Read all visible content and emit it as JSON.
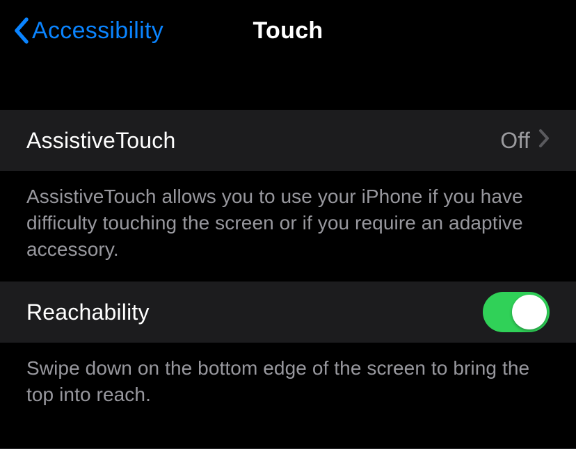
{
  "header": {
    "back_label": "Accessibility",
    "title": "Touch"
  },
  "sections": {
    "assistive_touch": {
      "label": "AssistiveTouch",
      "value": "Off",
      "footer": "AssistiveTouch allows you to use your iPhone if you have difficulty touching the screen or if you require an adaptive accessory."
    },
    "reachability": {
      "label": "Reachability",
      "footer": "Swipe down on the bottom edge of the screen to bring the top into reach."
    }
  }
}
